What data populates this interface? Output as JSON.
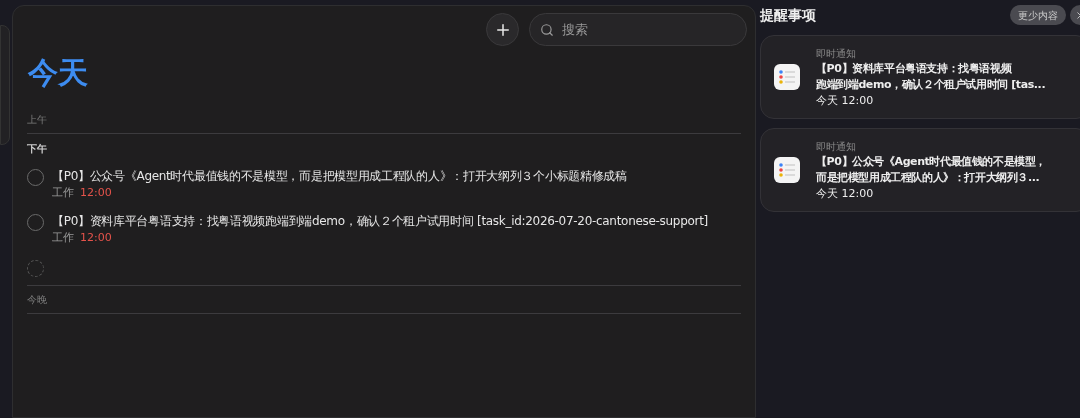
{
  "toolbar": {
    "search": {
      "placeholder": "搜索"
    }
  },
  "title": "今天",
  "sections": [
    {
      "label": "上午",
      "emphasis": false
    },
    {
      "label": "下午",
      "emphasis": true,
      "tasks": [
        {
          "title": "【P0】公众号《Agent时代最值钱的不是模型，而是把模型用成工程队的人》：打开大纲列３个小标题精修成稿",
          "list": "工作",
          "time": "12:00",
          "completed": false
        },
        {
          "title": "【P0】资料库平台粤语支持：找粤语视频跑端到端demo，确认２个租户试用时间 [task_id:2026-07-20-cantonese-support]",
          "list": "工作",
          "time": "12:00",
          "completed": false
        }
      ],
      "new_task": {
        "completed": false
      }
    },
    {
      "label": "今晚",
      "emphasis": false
    }
  ],
  "notifications": {
    "title": "提醒事项",
    "collapse_button": "更少内容",
    "items": [
      {
        "category": "即时通知",
        "lines": [
          "【P0】资料库平台粤语支持：找粤语视频",
          "跑端到端demo，确认２个租户试用时间 [tas..."
        ],
        "time": "今天 12:00"
      },
      {
        "category": "即时通知",
        "lines": [
          "【P0】公众号《Agent时代最值钱的不是模型，",
          "而是把模型用成工程队的人》：打开大纲列３..."
        ],
        "time": "今天 12:00"
      }
    ]
  }
}
